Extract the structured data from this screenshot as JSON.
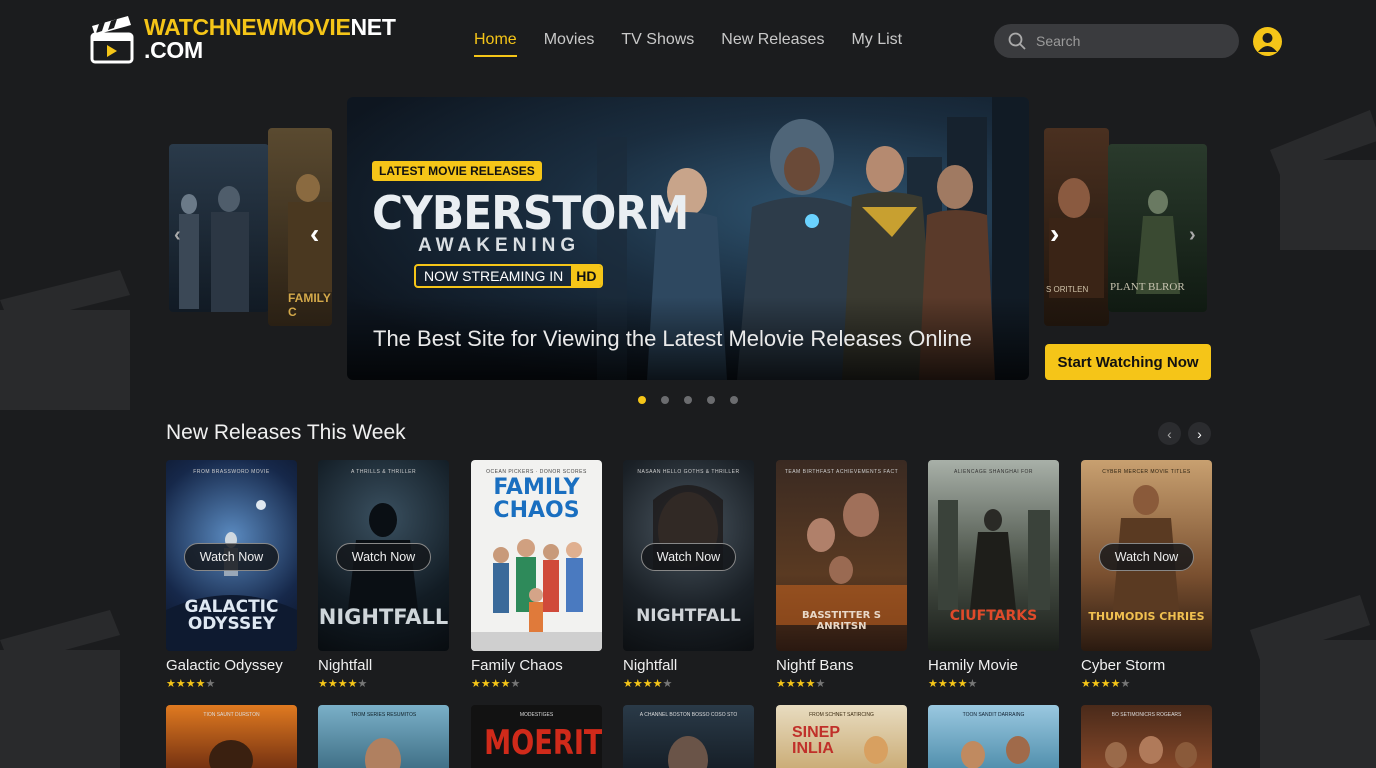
{
  "header": {
    "logo_line1_a": "WATCHNEWMOVIE",
    "logo_line1_b": "NET",
    "logo_line2": ".COM",
    "nav": [
      "Home",
      "Movies",
      "TV Shows",
      "New Releases",
      "My List"
    ],
    "active_nav": "Home",
    "search_placeholder": "Search"
  },
  "hero": {
    "badge": "LATEST MOVIE RELEASES",
    "title": "CYBERSTORM",
    "subtitle": "AWAKENING",
    "stream_text": "NOW STREAMING IN",
    "stream_hd": "HD",
    "tagline": "The Best Site for Viewing the Latest Melovie Releases Online",
    "cta": "Start Watching Now",
    "slide_count": 5,
    "active_slide": 1,
    "side_left_title": "FAMILY C",
    "side_right_title1": "S ORITLEN",
    "side_right_title2": "PLANT BLROR"
  },
  "section": {
    "title": "New Releases This Week",
    "watch_label": "Watch Now",
    "movies": [
      {
        "title": "Galactic Odyssey",
        "poster_title": "GALACTIC ODYSSEY",
        "rating": 4,
        "top": "FROM BRASSWORD MOVIE"
      },
      {
        "title": "Nightfall",
        "poster_title": "NIGHTFALL",
        "rating": 4,
        "top": "A THRILLS & THRILLER"
      },
      {
        "title": "Family Chaos",
        "poster_title": "FAMILY CHAOS",
        "rating": 4,
        "top": "OCEAN PICKERS · DONOR SCORES"
      },
      {
        "title": "Nightfall",
        "poster_title": "NIGHTFALL",
        "rating": 4,
        "top": "NASAAN HELLO GOTHS & THRILLER"
      },
      {
        "title": "Nightf Bans",
        "poster_title": "BASSTITTER S ANRITSN",
        "rating": 4,
        "top": "TEAM BIRTHFAST ACHIEVEMENTS FACT"
      },
      {
        "title": "Hamily Movie",
        "poster_title": "CIUFTARKS",
        "rating": 4,
        "top": "ALIENCAGE SHANGHAI FOR"
      },
      {
        "title": "Cyber Storm",
        "poster_title": "THUMODIS CHRIES",
        "rating": 4,
        "top": "CYBER MERCER MOVIE TITLES"
      }
    ],
    "row2": [
      {
        "top": "TION SAUNT DURSTON"
      },
      {
        "top": "TROM SERIES RESUMITOS"
      },
      {
        "top": "MODESTIGES",
        "title": "MOERITH"
      },
      {
        "top": "A CHANNEL BOSTON BOSSO COSO STO"
      },
      {
        "top": "FROM SCHNET SATIRCING",
        "title": "SINEP INLIA"
      },
      {
        "top": "TOON SANDIT DARRAING"
      },
      {
        "top": "BO SETIMONICRS ROGEARS"
      }
    ]
  },
  "colors": {
    "accent": "#f5c518",
    "background": "#1b1c1e"
  }
}
